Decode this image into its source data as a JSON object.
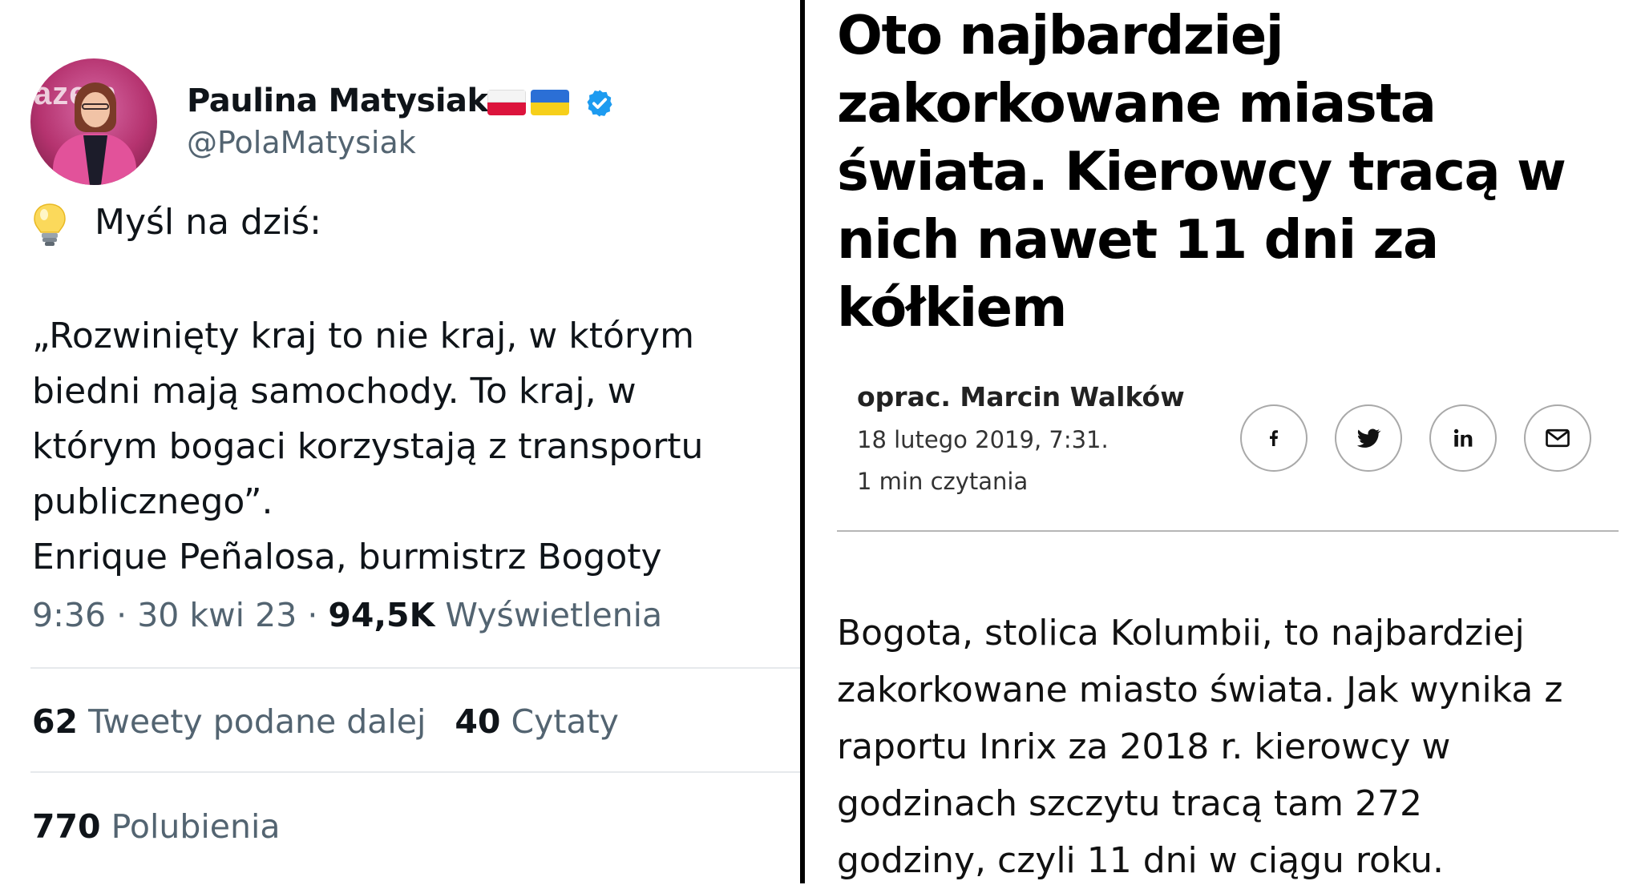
{
  "tweet": {
    "display_name": "Paulina Matysiak",
    "handle": "@PolaMatysiak",
    "avatar_text": "azem",
    "thought_label": "Myśl na dziś:",
    "quote_lines": [
      "„Rozwinięty kraj to nie kraj, w którym",
      "biedni mają samochody. To kraj, w",
      "którym bogaci korzystają z transportu",
      "publicznego”.",
      "Enrique Peñalosa, burmistrz Bogoty"
    ],
    "time": "9:36",
    "date": "30 kwi 23",
    "views_count": "94,5K",
    "views_label": "Wyświetlenia",
    "retweets_count": "62",
    "retweets_label": "Tweety podane dalej",
    "quotes_count": "40",
    "quotes_label": "Cytaty",
    "likes_count": "770",
    "likes_label": "Polubienia",
    "icons": [
      "flag-poland-icon",
      "flag-ukraine-icon",
      "verified-badge-icon",
      "lightbulb-icon"
    ],
    "colors": {
      "verified": "#1d9bf0",
      "secondary_text": "#536471",
      "divider": "#e6e9ec"
    }
  },
  "article": {
    "headline_lines": [
      "Oto najbardziej",
      "zakorkowane miasta",
      "świata. Kierowcy tracą w",
      "nich nawet 11 dni za",
      "kółkiem"
    ],
    "author": "oprac. Marcin Walków",
    "date": "18 lutego 2019, 7:31.",
    "read_time": "1 min czytania",
    "share_buttons": [
      "facebook-icon",
      "twitter-icon",
      "linkedin-icon",
      "email-icon"
    ],
    "body_lines": [
      "Bogota, stolica Kolumbii, to najbardziej",
      "zakorkowane miasto świata. Jak wynika z",
      "raportu Inrix za 2018 r. kierowcy w",
      "godzinach szczytu tracą tam 272",
      "godziny, czyli 11 dni w ciągu roku."
    ]
  }
}
